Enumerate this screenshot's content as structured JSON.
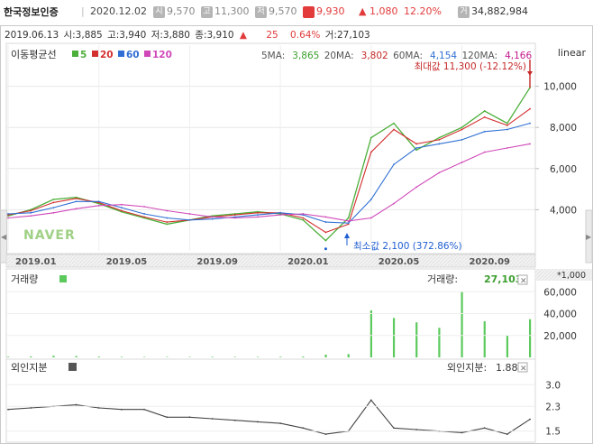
{
  "header": {
    "stock_name": "한국정보인증",
    "date": "2020.12.02",
    "open_icon": "시",
    "open": "9,570",
    "high_icon": "고",
    "high": "11,300",
    "low_icon": "저",
    "low": "9,570",
    "close_icon": "종",
    "close": "9,930",
    "change": "▲ 1,080",
    "change_pct": "12.20%",
    "volume_icon": "거",
    "volume": "34,882,984"
  },
  "info_line": {
    "date": "2019.06.13",
    "open_label": "시:",
    "open": "3,885",
    "high_label": "고:",
    "high": "3,940",
    "low_label": "저:",
    "low": "3,880",
    "close_label": "종:",
    "close": "3,910",
    "change": "25",
    "change_pct": "0.64%",
    "volume_label": "거:",
    "volume": "27,103"
  },
  "ma_legend": {
    "title": "이동평균선",
    "items": [
      {
        "label": "5",
        "color": "#4caf3a"
      },
      {
        "label": "20",
        "color": "#d32f2f"
      },
      {
        "label": "60",
        "color": "#2f6fd3"
      },
      {
        "label": "120",
        "color": "#d048b8"
      }
    ]
  },
  "ma_values": {
    "ma5_label": "5MA:",
    "ma5": "3,865",
    "ma20_label": "20MA:",
    "ma20": "3,802",
    "ma60_label": "60MA:",
    "ma60": "4,154",
    "ma120_label": "120MA:",
    "ma120": "4,166"
  },
  "scale_mode": "linear",
  "max_annotation": "최대값 11,300 (-12.12%)",
  "min_annotation": "최소값 2,100 (372.86%)",
  "watermark": "NAVER",
  "volume_panel": {
    "title": "거래량",
    "value_label": "거래량:",
    "value": "27,103",
    "unit": "*1,000",
    "color": "#5cc95c"
  },
  "foreign_panel": {
    "title": "외인지분",
    "value_label": "외인지분:",
    "value": "1.88",
    "color": "#555555"
  },
  "close_icon": "close-icon",
  "arrow_left_icon": "arrow-left-icon",
  "arrow_right_icon": "arrow-right-icon",
  "chart_data": [
    {
      "type": "line",
      "title": "",
      "x": [
        "2019.01",
        "2019.02",
        "2019.03",
        "2019.04",
        "2019.05",
        "2019.06",
        "2019.07",
        "2019.08",
        "2019.09",
        "2019.10",
        "2019.11",
        "2019.12",
        "2020.01",
        "2020.02",
        "2020.03",
        "2020.04",
        "2020.05",
        "2020.06",
        "2020.07",
        "2020.08",
        "2020.09",
        "2020.10",
        "2020.11",
        "2020.12"
      ],
      "xticks": [
        "2019.01",
        "2019.05",
        "2019.09",
        "2020.01",
        "2020.05",
        "2020.09"
      ],
      "yticks": [
        4000,
        6000,
        8000,
        10000
      ],
      "ylim": [
        2000,
        12000
      ],
      "series": [
        {
          "name": "5",
          "color": "#4caf3a",
          "values": [
            3700,
            4000,
            4500,
            4600,
            4300,
            3900,
            3600,
            3300,
            3500,
            3700,
            3800,
            3900,
            3800,
            3500,
            2500,
            3600,
            7500,
            8200,
            6900,
            7500,
            8000,
            8800,
            8200,
            9930
          ]
        },
        {
          "name": "20",
          "color": "#d32f2f",
          "values": [
            3750,
            3950,
            4350,
            4550,
            4350,
            3950,
            3650,
            3400,
            3500,
            3650,
            3750,
            3850,
            3850,
            3600,
            2900,
            3300,
            6800,
            7900,
            7200,
            7400,
            7900,
            8500,
            8100,
            8900
          ]
        },
        {
          "name": "60",
          "color": "#2f6fd3",
          "values": [
            3800,
            3850,
            4100,
            4400,
            4400,
            4100,
            3800,
            3600,
            3500,
            3550,
            3650,
            3750,
            3850,
            3750,
            3400,
            3350,
            4500,
            6200,
            7000,
            7200,
            7400,
            7800,
            7900,
            8200
          ]
        },
        {
          "name": "120",
          "color": "#d048b8",
          "values": [
            3600,
            3700,
            3850,
            4050,
            4200,
            4250,
            4150,
            3950,
            3800,
            3650,
            3600,
            3650,
            3750,
            3800,
            3650,
            3450,
            3600,
            4300,
            5100,
            5800,
            6300,
            6800,
            7000,
            7200
          ]
        }
      ],
      "max": {
        "x": "2020.12",
        "value": 11300
      },
      "min": {
        "x": "2020.03",
        "value": 2100
      }
    },
    {
      "type": "bar",
      "title": "거래량",
      "unit": "*1,000",
      "x": [
        "2019.01",
        "2019.02",
        "2019.03",
        "2019.04",
        "2019.05",
        "2019.06",
        "2019.07",
        "2019.08",
        "2019.09",
        "2019.10",
        "2019.11",
        "2019.12",
        "2020.01",
        "2020.02",
        "2020.03",
        "2020.04",
        "2020.05",
        "2020.06",
        "2020.07",
        "2020.08",
        "2020.09",
        "2020.10",
        "2020.11",
        "2020.12"
      ],
      "values": [
        600,
        900,
        1500,
        1200,
        700,
        500,
        400,
        450,
        400,
        500,
        400,
        450,
        600,
        800,
        2500,
        3000,
        43000,
        36000,
        32000,
        27000,
        60000,
        33000,
        20000,
        34883
      ],
      "yticks": [
        20000,
        40000,
        60000
      ],
      "ylim": [
        0,
        66000
      ]
    },
    {
      "type": "line",
      "title": "외인지분",
      "x": [
        "2019.01",
        "2019.02",
        "2019.03",
        "2019.04",
        "2019.05",
        "2019.06",
        "2019.07",
        "2019.08",
        "2019.09",
        "2019.10",
        "2019.11",
        "2019.12",
        "2020.01",
        "2020.02",
        "2020.03",
        "2020.04",
        "2020.05",
        "2020.06",
        "2020.07",
        "2020.08",
        "2020.09",
        "2020.10",
        "2020.11",
        "2020.12"
      ],
      "values": [
        2.2,
        2.25,
        2.3,
        2.35,
        2.25,
        2.2,
        2.2,
        1.95,
        1.95,
        1.9,
        1.85,
        1.8,
        1.75,
        1.6,
        1.4,
        1.5,
        2.5,
        1.6,
        1.55,
        1.5,
        1.45,
        1.6,
        1.4,
        1.88
      ],
      "yticks": [
        1.5,
        2.3,
        3.0
      ],
      "ylim": [
        1.2,
        3.3
      ]
    }
  ]
}
